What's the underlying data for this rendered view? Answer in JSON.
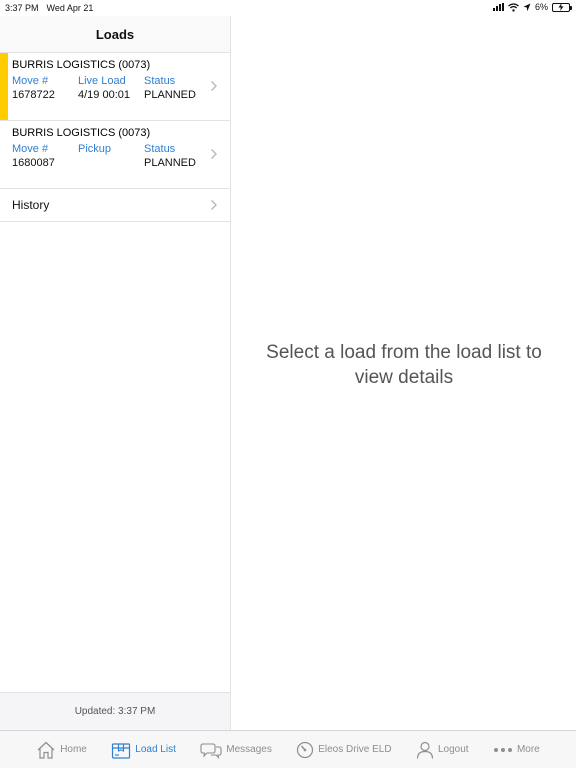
{
  "status_bar": {
    "time": "3:37 PM",
    "date": "Wed Apr 21",
    "battery": "6%"
  },
  "nav": {
    "title": "Loads"
  },
  "loads": [
    {
      "company": "BURRIS LOGISTICS (0073)",
      "col1_label": "Move #",
      "col1_value": "1678722",
      "col2_label": "Live Load",
      "col2_value": "4/19 00:01",
      "col3_label": "Status",
      "col3_value": "PLANNED",
      "selected": true
    },
    {
      "company": "BURRIS LOGISTICS (0073)",
      "col1_label": "Move #",
      "col1_value": "1680087",
      "col2_label": "Pickup",
      "col2_value": "",
      "col3_label": "Status",
      "col3_value": "PLANNED",
      "selected": false
    }
  ],
  "history": {
    "label": "History"
  },
  "footer": {
    "updated": "Updated: 3:37 PM"
  },
  "detail": {
    "placeholder": "Select a load from the load list to view details"
  },
  "tabs": [
    {
      "label": "Home",
      "icon": "home-icon"
    },
    {
      "label": "Load List",
      "icon": "box-icon",
      "active": true
    },
    {
      "label": "Messages",
      "icon": "chat-icon"
    },
    {
      "label": "Eleos Drive ELD",
      "icon": "gauge-icon"
    },
    {
      "label": "Logout",
      "icon": "person-icon"
    },
    {
      "label": "More",
      "icon": "more-icon"
    }
  ],
  "colors": {
    "accent": "#2f7fd1",
    "selected_bar": "#ffcc00"
  }
}
